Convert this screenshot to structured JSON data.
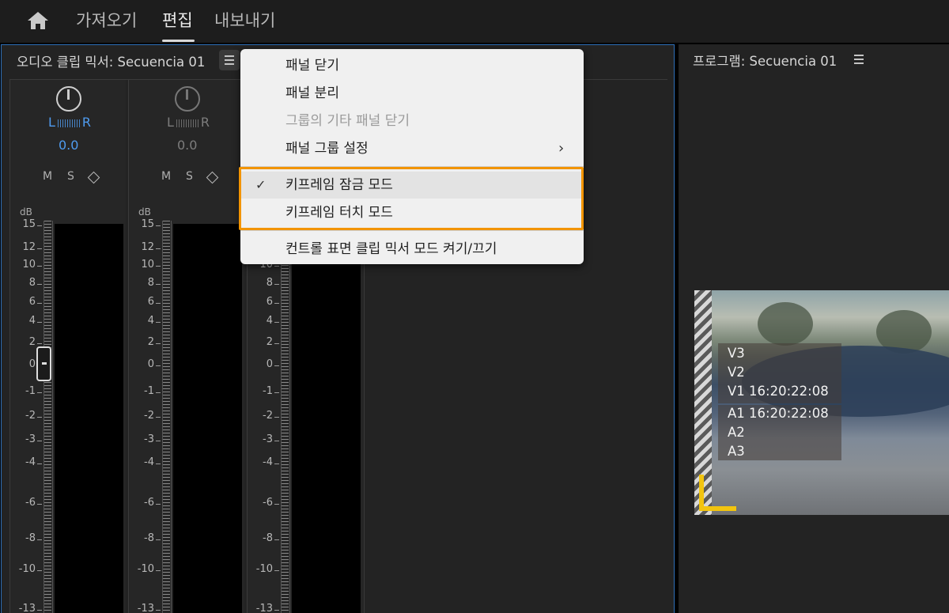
{
  "workspace_tabs": [
    {
      "label": "가져오기"
    },
    {
      "label": "편집"
    },
    {
      "label": "내보내기"
    }
  ],
  "mixer": {
    "title": "오디오 클립 믹서: Secuencia 01",
    "channels": [
      {
        "left": "L",
        "right": "R",
        "pan_value": "0.0",
        "m": "M",
        "s": "S"
      },
      {
        "left": "L",
        "right": "R",
        "pan_value": "0.0",
        "m": "M",
        "s": "S"
      }
    ],
    "db_label": "dB",
    "scale": [
      "15",
      "12",
      "10",
      "8",
      "6",
      "4",
      "2",
      "0",
      "-1",
      "-2",
      "-3",
      "-4",
      "-6",
      "-8",
      "-10",
      "-13"
    ]
  },
  "program": {
    "title": "프로그램: Secuencia 01",
    "overlay_video": [
      "V3",
      "V2",
      "V1 16:20:22:08"
    ],
    "overlay_audio": [
      "A1 16:20:22:08",
      "A2",
      "A3"
    ]
  },
  "menu": {
    "items": [
      {
        "label": "패널 닫기"
      },
      {
        "label": "패널 분리"
      },
      {
        "label": "그룹의 기타 패널 닫기"
      },
      {
        "label": "패널 그룹 설정"
      },
      {
        "label": "키프레임 잠금 모드"
      },
      {
        "label": "키프레임 터치 모드"
      },
      {
        "label": "컨트롤 표면 클립 믹서 모드 켜기/끄기"
      }
    ],
    "check_glyph": "✓",
    "submenu_glyph": "›"
  },
  "colors": {
    "accent_blue": "#4f9cf0",
    "highlight_orange": "#f29400",
    "safe_mark_yellow": "#f2c40f"
  }
}
